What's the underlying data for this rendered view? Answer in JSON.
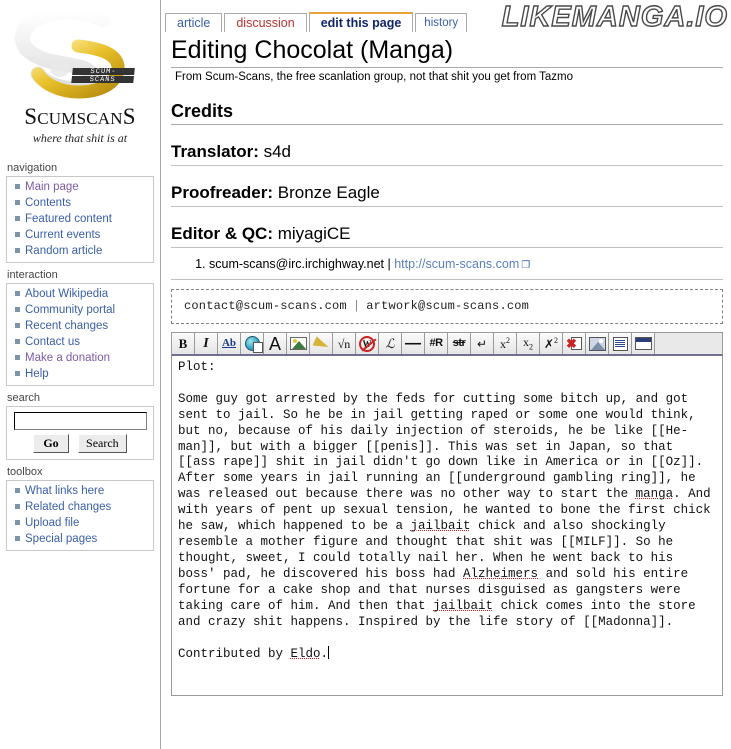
{
  "site": {
    "brand_first": "S",
    "brand_rest": "CUMSCAN",
    "brand_last": "S",
    "brand_full": "ScumscanS",
    "tagline": "where that shit is at",
    "badge_line1": "SCUM-",
    "badge_line2": "SCANS",
    "watermark": "LIKEMANGA.IO"
  },
  "tabs": [
    {
      "label": "article",
      "state": "normal"
    },
    {
      "label": "discussion",
      "state": "new"
    },
    {
      "label": "edit this page",
      "state": "selected"
    },
    {
      "label": "history",
      "state": "normal"
    }
  ],
  "sidebar": {
    "navigation": {
      "title": "navigation",
      "items": [
        {
          "label": "Main page",
          "visited": true
        },
        {
          "label": "Contents",
          "visited": false
        },
        {
          "label": "Featured content",
          "visited": false
        },
        {
          "label": "Current events",
          "visited": false
        },
        {
          "label": "Random article",
          "visited": false
        }
      ]
    },
    "interaction": {
      "title": "interaction",
      "items": [
        {
          "label": "About Wikipedia",
          "visited": false
        },
        {
          "label": "Community portal",
          "visited": false
        },
        {
          "label": "Recent changes",
          "visited": false
        },
        {
          "label": "Contact us",
          "visited": false
        },
        {
          "label": "Make a donation",
          "visited": true
        },
        {
          "label": "Help",
          "visited": false
        }
      ]
    },
    "search": {
      "title": "search",
      "input_value": "",
      "placeholder": "",
      "go_label": "Go",
      "search_label": "Search"
    },
    "toolbox": {
      "title": "toolbox",
      "items": [
        {
          "label": "What links here",
          "visited": false
        },
        {
          "label": "Related changes",
          "visited": false
        },
        {
          "label": "Upload file",
          "visited": false
        },
        {
          "label": "Special pages",
          "visited": false
        }
      ]
    }
  },
  "page": {
    "title": "Editing Chocolat (Manga)",
    "subtitle": "From Scum-Scans, the free scanlation group, not that shit you get from Tazmo",
    "credits_heading": "Credits",
    "credits": [
      {
        "role": "Translator:",
        "name": "s4d"
      },
      {
        "role": "Proofreader:",
        "name": "Bronze Eagle"
      },
      {
        "role": "Editor & QC:",
        "name": "miyagiCE"
      }
    ],
    "contact_item": {
      "irc": "scum-scans@irc.irchighway.net",
      "separator": "|",
      "url_text": "http://scum-scans.com",
      "ext_icon": "❐"
    },
    "contact_box": {
      "email1": "contact@scum-scans.com",
      "separator": "|",
      "email2": "artwork@scum-scans.com"
    }
  },
  "toolbar": {
    "buttons": [
      {
        "name": "bold",
        "glyph": "B",
        "kind": "bold",
        "title": "Bold text"
      },
      {
        "name": "italic",
        "glyph": "I",
        "kind": "italic",
        "title": "Italic text"
      },
      {
        "name": "internal-link",
        "glyph": "Ab",
        "kind": "link",
        "title": "Internal link"
      },
      {
        "name": "external-link",
        "glyph": "",
        "kind": "globe",
        "title": "External link"
      },
      {
        "name": "headline",
        "glyph": "A",
        "kind": "bigA",
        "title": "Level 2 headline"
      },
      {
        "name": "embedded-image",
        "glyph": "",
        "kind": "pic",
        "title": "Embedded image"
      },
      {
        "name": "media-file",
        "glyph": "",
        "kind": "trumpet",
        "title": "Media file link"
      },
      {
        "name": "math-formula",
        "glyph": "√n",
        "kind": "sqrt",
        "title": "Mathematical formula"
      },
      {
        "name": "ignore-wiki",
        "glyph": "W",
        "kind": "nosign",
        "title": "Ignore wiki formatting"
      },
      {
        "name": "signature",
        "glyph": "ℒ",
        "kind": "sig",
        "title": "Your signature with timestamp"
      },
      {
        "name": "horizontal-line",
        "glyph": "—",
        "kind": "dash",
        "title": "Horizontal line"
      },
      {
        "name": "redirect",
        "glyph": "#R",
        "kind": "hash",
        "title": "Redirect"
      },
      {
        "name": "strikethrough",
        "glyph": "str",
        "kind": "strike",
        "title": "Strike"
      },
      {
        "name": "line-break",
        "glyph": "↵",
        "kind": "plain",
        "title": "Line break"
      },
      {
        "name": "superscript",
        "glyph": "x²",
        "kind": "sup",
        "title": "Superscript"
      },
      {
        "name": "subscript",
        "glyph": "x₂",
        "kind": "sup",
        "title": "Subscript"
      },
      {
        "name": "small-text",
        "glyph": "✕²",
        "kind": "sup",
        "title": "Small text"
      },
      {
        "name": "hide-comment",
        "glyph": "",
        "kind": "redx",
        "title": "Insert hidden comment"
      },
      {
        "name": "image-gallery",
        "glyph": "",
        "kind": "photo",
        "title": "Insert a picture gallery"
      },
      {
        "name": "block-quote",
        "glyph": "",
        "kind": "lines",
        "title": "Insert block of quoted text"
      },
      {
        "name": "table",
        "glyph": "",
        "kind": "win",
        "title": "Insert a table"
      }
    ]
  },
  "editor": {
    "text_head": "Plot:",
    "blank": "",
    "paragraph_parts": [
      {
        "t": "Some guy got arrested by the feds for cutting some bitch up, and got sent to jail. So he be in jail getting raped or some one would think, but no, because of his daily injection of steroids, he be like [[He-man]], but with a bigger [[penis]]. This was set in Japan, so that [[ass rape]] shit in jail didn't go down like in America or in [[Oz]]. After some years in jail running an [[underground gambling ring]], he was released out because there was no other way to start the ",
        "spell": false
      },
      {
        "t": "manga",
        "spell": true
      },
      {
        "t": ". And with years of pent up sexual tension, he wanted to bone the first chick he saw, which happened to be a ",
        "spell": false
      },
      {
        "t": "jailbait",
        "spell": true
      },
      {
        "t": " chick and also shockingly resemble a mother figure and thought that shit was [[MILF]]. So he thought, sweet, I could totally nail her. When he went back to his boss' pad, he discovered his boss had ",
        "spell": false
      },
      {
        "t": "Alzheimers",
        "spell": true
      },
      {
        "t": " and sold his entire fortune for a cake shop and that nurses disguised as gangsters were taking care of him. And then that ",
        "spell": false
      },
      {
        "t": "jailbait",
        "spell": true
      },
      {
        "t": " chick comes into the store and crazy shit happens. Inspired by the life story of [[Madonna]].",
        "spell": false
      }
    ],
    "signature_parts": [
      {
        "t": "Contributed by ",
        "spell": false
      },
      {
        "t": "Eldo",
        "spell": true
      },
      {
        "t": ".",
        "spell": false
      }
    ],
    "full_text": "Plot:\n\nSome guy got arrested by the feds for cutting some bitch up, and got sent to jail. So he be in jail getting raped or some one would think, but no, because of his daily injection of steroids, he be like [[He-man]], but with a bigger [[penis]]. This was set in Japan, so that [[ass rape]] shit in jail didn't go down like in America or in [[Oz]]. After some years in jail running an [[underground gambling ring]], he was released out because there was no other way to start the manga. And with years of pent up sexual tension, he wanted to bone the first chick he saw, which happened to be a jailbait chick and also shockingly resemble a mother figure and thought that shit was [[MILF]]. So he thought, sweet, I could totally nail her. When he went back to his boss' pad, he discovered his boss had Alzheimers and sold his entire fortune for a cake shop and that nurses disguised as gangsters were taking care of him. And then that jailbait chick comes into the store and crazy shit happens. Inspired by the life story of [[Madonna]].\n\nContributed by Eldo."
  },
  "colors": {
    "link": "#3a5fa8",
    "visited_link": "#7d5ba6",
    "new_link": "#b8312f",
    "tab_accent": "#e8a33d",
    "spell_underline": "#d02020"
  }
}
